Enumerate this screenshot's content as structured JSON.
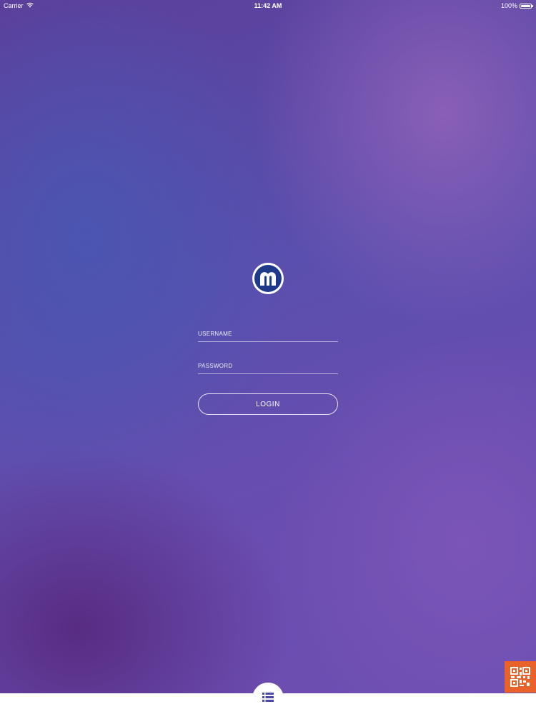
{
  "status_bar": {
    "carrier": "Carrier",
    "time": "11:42 AM",
    "battery_text": "100%",
    "battery_level": 1.0
  },
  "logo": {
    "letter": "m",
    "outer_color": "#ffffff",
    "inner_color": "#1f3a8a"
  },
  "login_form": {
    "username_placeholder": "USERNAME",
    "password_placeholder": "PASSWORD",
    "login_label": "LOGIN"
  },
  "icons": {
    "menu": "list-icon",
    "qr": "qr-code-icon"
  },
  "colors": {
    "accent": "#e8622a",
    "menu_icon": "#4b4aa8"
  }
}
